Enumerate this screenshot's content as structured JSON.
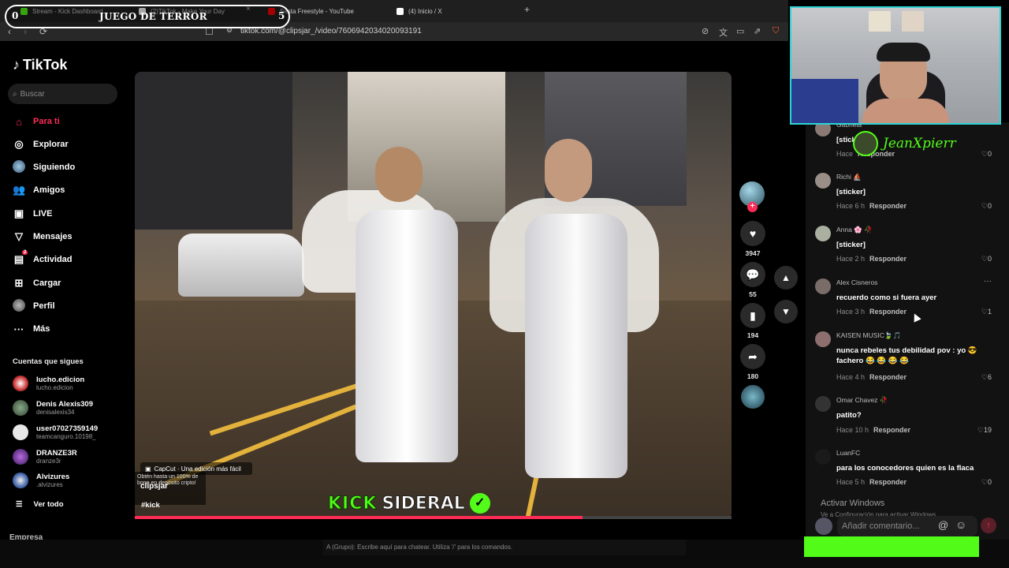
{
  "browser": {
    "tabs": [
      {
        "label": "Stream - Kick Dashboard",
        "color": "#53fc18"
      },
      {
        "label": "(2)TikTok - Make Your Day",
        "color": "#ffffff"
      },
      {
        "label": "Sesta Freestyle - YouTube",
        "color": "#ff0000"
      },
      {
        "label": "(4) Inicio / X",
        "color": "#ffffff"
      }
    ],
    "close_symbol": "×",
    "new_tab_symbol": "+",
    "url": "tiktok.com/@clipsjar_/video/7606942034020093191"
  },
  "overlay": {
    "left_score": "0",
    "title": "JUEGO DE TERROR",
    "right_score": "5"
  },
  "sidebar": {
    "brand": "TikTok",
    "search_placeholder": "Buscar",
    "nav": [
      {
        "label": "Para ti",
        "icon": "home-icon"
      },
      {
        "label": "Explorar",
        "icon": "compass-icon"
      },
      {
        "label": "Siguiendo",
        "icon": "following-icon"
      },
      {
        "label": "Amigos",
        "icon": "friends-icon"
      },
      {
        "label": "LIVE",
        "icon": "live-icon"
      },
      {
        "label": "Mensajes",
        "icon": "messages-icon"
      },
      {
        "label": "Actividad",
        "icon": "activity-icon",
        "badge": "2"
      },
      {
        "label": "Cargar",
        "icon": "upload-icon"
      },
      {
        "label": "Perfil",
        "icon": "profile-icon"
      },
      {
        "label": "Más",
        "icon": "more-icon"
      }
    ],
    "following_title": "Cuentas que sigues",
    "following": [
      {
        "name": "lucho.edicion",
        "user": "lucho.edicion"
      },
      {
        "name": "Denis Alexis309",
        "user": "denisalexis34"
      },
      {
        "name": "user07027359149",
        "user": "teamcanguro.10198_"
      },
      {
        "name": "DRANZE3R",
        "user": "dranze3r"
      },
      {
        "name": "Alvizures",
        "user": ".alvizures"
      }
    ],
    "see_all": "Ver todo",
    "company": "Empresa"
  },
  "video": {
    "capcut_label": "CapCut · Una edición más fácil",
    "promo_text": "Obtén hasta un 100% de bono en depósito cripto!",
    "author": "clipsjar",
    "hashtag": "#kick",
    "watermark_left": "KICK",
    "watermark_right": "SIDERAL",
    "progress": 0.75
  },
  "actions": {
    "likes": "3947",
    "comments": "55",
    "saves": "194",
    "shares": "180"
  },
  "streamer": {
    "name": "JeanXpierr"
  },
  "comments": [
    {
      "user": "Gabriela",
      "text": "[sticker]",
      "time": "Hace",
      "reply": "Responder",
      "likes": "0"
    },
    {
      "user": "Richi ⛵",
      "text": "[sticker]",
      "time": "Hace 6 h",
      "reply": "Responder",
      "likes": "0"
    },
    {
      "user": "Anna 🌸 🥀",
      "text": "[sticker]",
      "time": "Hace 2 h",
      "reply": "Responder",
      "likes": "0"
    },
    {
      "user": "Alex Cisneros",
      "text": "recuerdo como si fuera ayer",
      "time": "Hace 3 h",
      "reply": "Responder",
      "likes": "1"
    },
    {
      "user": "KAISEN MUSIC🍃🎵",
      "text": "nunca rebeles tus debilidad pov : yo 😎 fachero 😂 😂 😂 😂",
      "time": "Hace 4 h",
      "reply": "Responder",
      "likes": "6"
    },
    {
      "user": "Omar Chavez 🥀",
      "text": "patito?",
      "time": "Hace 10 h",
      "reply": "Responder",
      "likes": "19"
    },
    {
      "user": "LuanFC",
      "text": "para los conocedores quien es la flaca",
      "time": "Hace 5 h",
      "reply": "Responder",
      "likes": "0"
    }
  ],
  "windows_notice": {
    "title": "Activar Windows",
    "subtitle": "Ve a Configuración para activar Windows."
  },
  "comment_input": {
    "placeholder": "Añadir comentario..."
  },
  "stream_chat": {
    "placeholder": "A (Grupo): Escribe aquí para chatear. Utiliza '/' para los comandos."
  },
  "colors": {
    "tiktok_red": "#fe2c55",
    "kick_green": "#53fc18",
    "webcam_border": "#2fd3d3"
  }
}
